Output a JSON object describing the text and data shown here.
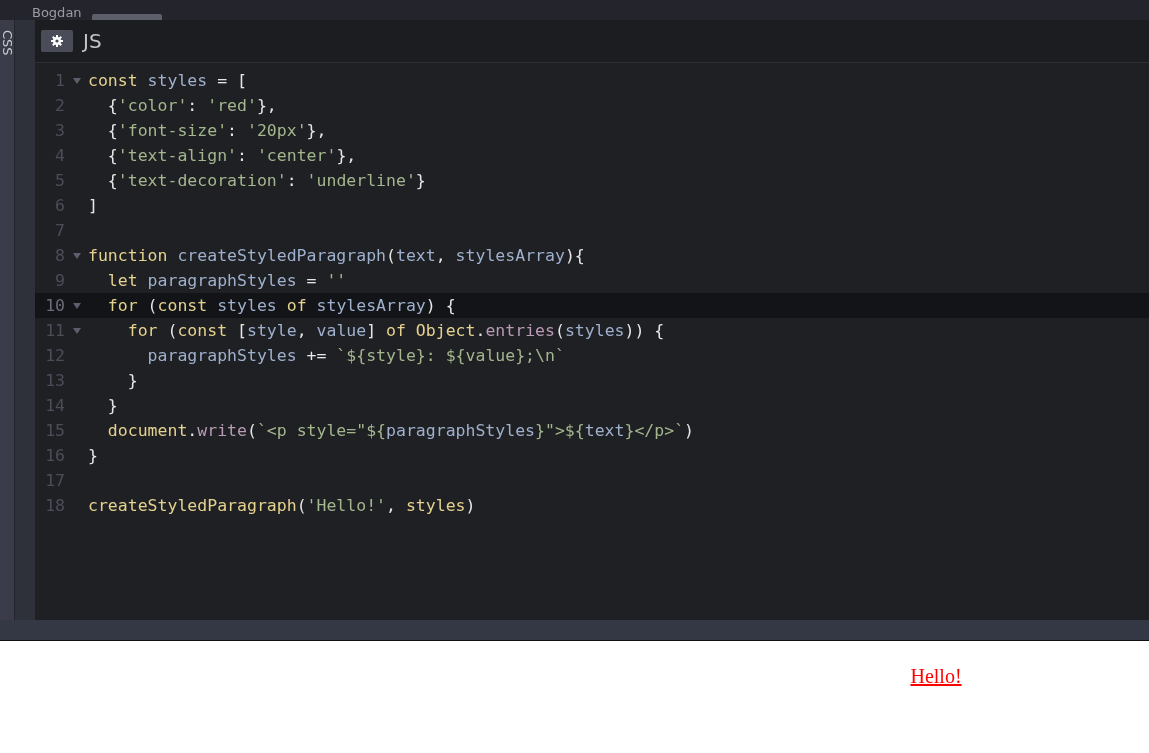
{
  "top_bar": {
    "user": "Bogdan"
  },
  "side_tab": {
    "label": "CSS"
  },
  "editor": {
    "title": "JS",
    "lines": [
      {
        "number": "1",
        "fold": true,
        "active": false,
        "tokens": [
          {
            "kind": "keyword",
            "text": "const"
          },
          {
            "kind": "variable",
            "text": " styles"
          },
          {
            "kind": "plain",
            "text": " = ["
          }
        ]
      },
      {
        "number": "2",
        "fold": false,
        "active": false,
        "tokens": [
          {
            "kind": "plain",
            "text": "  {"
          },
          {
            "kind": "string",
            "text": "'color'"
          },
          {
            "kind": "plain",
            "text": ":"
          },
          {
            "kind": "string",
            "text": " 'red'"
          },
          {
            "kind": "plain",
            "text": "},"
          }
        ]
      },
      {
        "number": "3",
        "fold": false,
        "active": false,
        "tokens": [
          {
            "kind": "plain",
            "text": "  {"
          },
          {
            "kind": "string",
            "text": "'font-size'"
          },
          {
            "kind": "plain",
            "text": ":"
          },
          {
            "kind": "string",
            "text": " '20px'"
          },
          {
            "kind": "plain",
            "text": "},"
          }
        ]
      },
      {
        "number": "4",
        "fold": false,
        "active": false,
        "tokens": [
          {
            "kind": "plain",
            "text": "  {"
          },
          {
            "kind": "string",
            "text": "'text-align'"
          },
          {
            "kind": "plain",
            "text": ":"
          },
          {
            "kind": "string",
            "text": " 'center'"
          },
          {
            "kind": "plain",
            "text": "},"
          }
        ]
      },
      {
        "number": "5",
        "fold": false,
        "active": false,
        "tokens": [
          {
            "kind": "plain",
            "text": "  {"
          },
          {
            "kind": "string",
            "text": "'text-decoration'"
          },
          {
            "kind": "plain",
            "text": ":"
          },
          {
            "kind": "string",
            "text": " 'underline'"
          },
          {
            "kind": "plain",
            "text": "}"
          }
        ]
      },
      {
        "number": "6",
        "fold": false,
        "active": false,
        "tokens": [
          {
            "kind": "plain",
            "text": "]"
          }
        ]
      },
      {
        "number": "7",
        "fold": false,
        "active": false
      },
      {
        "number": "8",
        "fold": true,
        "active": false,
        "tokens": [
          {
            "kind": "keyword",
            "text": "function"
          },
          {
            "kind": "variable",
            "text": " createStyledParagraph"
          },
          {
            "kind": "plain",
            "text": "("
          },
          {
            "kind": "variable",
            "text": "text"
          },
          {
            "kind": "plain",
            "text": ","
          },
          {
            "kind": "variable",
            "text": " stylesArray"
          },
          {
            "kind": "plain",
            "text": "){"
          }
        ]
      },
      {
        "number": "9",
        "fold": false,
        "active": false,
        "tokens": [
          {
            "kind": "keyword",
            "text": "  let"
          },
          {
            "kind": "variable",
            "text": " paragraphStyles"
          },
          {
            "kind": "plain",
            "text": " ="
          },
          {
            "kind": "string",
            "text": " ''"
          }
        ]
      },
      {
        "number": "10",
        "fold": true,
        "active": true,
        "tokens": [
          {
            "kind": "keyword",
            "text": "  for"
          },
          {
            "kind": "plain",
            "text": " ("
          },
          {
            "kind": "keyword",
            "text": "const"
          },
          {
            "kind": "variable",
            "text": " styles"
          },
          {
            "kind": "keyword",
            "text": " of"
          },
          {
            "kind": "variable",
            "text": " stylesArray"
          },
          {
            "kind": "plain",
            "text": ") {"
          }
        ]
      },
      {
        "number": "11",
        "fold": true,
        "active": false,
        "tokens": [
          {
            "kind": "keyword",
            "text": "    for"
          },
          {
            "kind": "plain",
            "text": " ("
          },
          {
            "kind": "keyword",
            "text": "const"
          },
          {
            "kind": "plain",
            "text": " ["
          },
          {
            "kind": "variable",
            "text": "style"
          },
          {
            "kind": "plain",
            "text": ","
          },
          {
            "kind": "variable",
            "text": " value"
          },
          {
            "kind": "plain",
            "text": "]"
          },
          {
            "kind": "keyword",
            "text": " of"
          },
          {
            "kind": "keyword",
            "text": " Object"
          },
          {
            "kind": "plain",
            "text": "."
          },
          {
            "kind": "method",
            "text": "entries"
          },
          {
            "kind": "plain",
            "text": "("
          },
          {
            "kind": "variable",
            "text": "styles"
          },
          {
            "kind": "plain",
            "text": ")) {"
          }
        ]
      },
      {
        "number": "12",
        "fold": false,
        "active": false,
        "tokens": [
          {
            "kind": "variable",
            "text": "      paragraphStyles"
          },
          {
            "kind": "plain",
            "text": " +="
          },
          {
            "kind": "string",
            "text": " `${style}: ${value};\\n`"
          }
        ]
      },
      {
        "number": "13",
        "fold": false,
        "active": false,
        "tokens": [
          {
            "kind": "plain",
            "text": "    }"
          }
        ]
      },
      {
        "number": "14",
        "fold": false,
        "active": false,
        "tokens": [
          {
            "kind": "plain",
            "text": "  }"
          }
        ]
      },
      {
        "number": "15",
        "fold": false,
        "active": false,
        "tokens": [
          {
            "kind": "keyword",
            "text": "  document"
          },
          {
            "kind": "plain",
            "text": "."
          },
          {
            "kind": "method",
            "text": "write"
          },
          {
            "kind": "plain",
            "text": "("
          },
          {
            "kind": "string",
            "text": "`<p style=\"${"
          },
          {
            "kind": "variable",
            "text": "paragraphStyles"
          },
          {
            "kind": "string",
            "text": "}\">${"
          },
          {
            "kind": "variable",
            "text": "text"
          },
          {
            "kind": "string",
            "text": "}</p>`"
          },
          {
            "kind": "plain",
            "text": ")"
          }
        ]
      },
      {
        "number": "16",
        "fold": false,
        "active": false,
        "tokens": [
          {
            "kind": "plain",
            "text": "}"
          }
        ]
      },
      {
        "number": "17",
        "fold": false,
        "active": false
      },
      {
        "number": "18",
        "fold": false,
        "active": false,
        "tokens": [
          {
            "kind": "keyword",
            "text": "createStyledParagraph"
          },
          {
            "kind": "plain",
            "text": "("
          },
          {
            "kind": "string",
            "text": "'Hello!'"
          },
          {
            "kind": "plain",
            "text": ","
          },
          {
            "kind": "keyword",
            "text": " styles"
          },
          {
            "kind": "plain",
            "text": ")"
          }
        ]
      }
    ]
  },
  "preview": {
    "text": "Hello!"
  }
}
